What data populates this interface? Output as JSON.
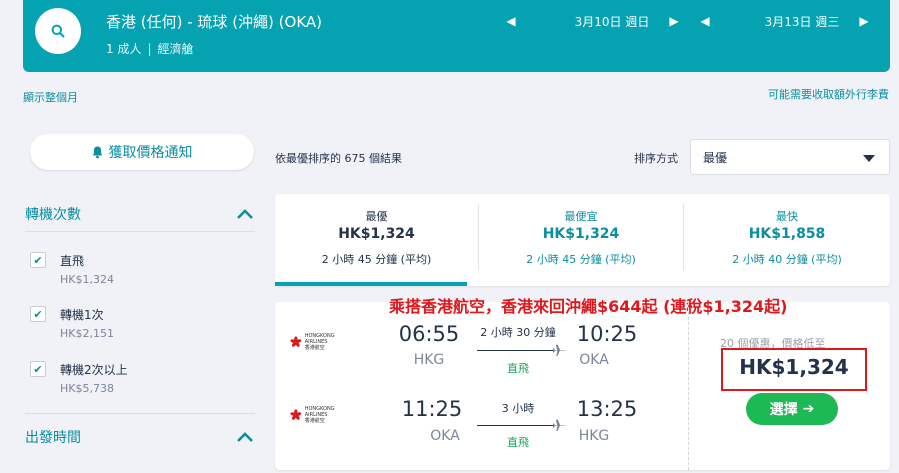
{
  "search": {
    "route": "香港 (任何) - 琉球 (沖繩) (OKA)",
    "passengers": "1 成人",
    "cabin": "經濟艙",
    "depart_date": "3月10日 週日",
    "return_date": "3月13日 週三"
  },
  "links": {
    "show_month": "顯示整個月",
    "baggage_fees": "可能需要收取額外行李費"
  },
  "alert_button": "獲取價格通知",
  "filters": {
    "stops_title": "轉機次數",
    "options": [
      {
        "label": "直飛",
        "price": "HK$1,324",
        "checked": true
      },
      {
        "label": "轉機1次",
        "price": "HK$2,151",
        "checked": true
      },
      {
        "label": "轉機2次以上",
        "price": "HK$5,738",
        "checked": true
      }
    ],
    "departure_title": "出發時間"
  },
  "results": {
    "count_text": "依最優排序的 675 個結果",
    "sort_label": "排序方式",
    "sort_value": "最優"
  },
  "tabs": [
    {
      "name": "最優",
      "price": "HK$1,324",
      "duration": "2 小時 45 分鐘 (平均)",
      "active": true
    },
    {
      "name": "最便宜",
      "price": "HK$1,324",
      "duration": "2 小時 45 分鐘 (平均)",
      "active": false
    },
    {
      "name": "最快",
      "price": "HK$1,858",
      "duration": "2 小時 40 分鐘 (平均)",
      "active": false
    }
  ],
  "promo_text": "乘搭香港航空，香港來回沖繩$644起 (連稅$1,324起)",
  "flight_card": {
    "airline_name_en": "HONGKONG AIRLINES",
    "airline_name_zh": "香港航空",
    "legs": [
      {
        "depart_time": "06:55",
        "depart_airport": "HKG",
        "duration": "2 小時 30 分鐘",
        "stops": "直飛",
        "arrive_time": "10:25",
        "arrive_airport": "OKA"
      },
      {
        "depart_time": "11:25",
        "depart_airport": "OKA",
        "duration": "3 小時",
        "stops": "直飛",
        "arrive_time": "13:25",
        "arrive_airport": "HKG"
      }
    ],
    "deals_text": "20 個優惠，價格低至",
    "price": "HK$1,324",
    "select_label": "選擇"
  },
  "colors": {
    "brand_teal": "#05a3b1",
    "link_teal": "#0a8ea0",
    "promo_red": "#e0181e",
    "select_green": "#1db954",
    "direct_green": "#1aa55a"
  }
}
